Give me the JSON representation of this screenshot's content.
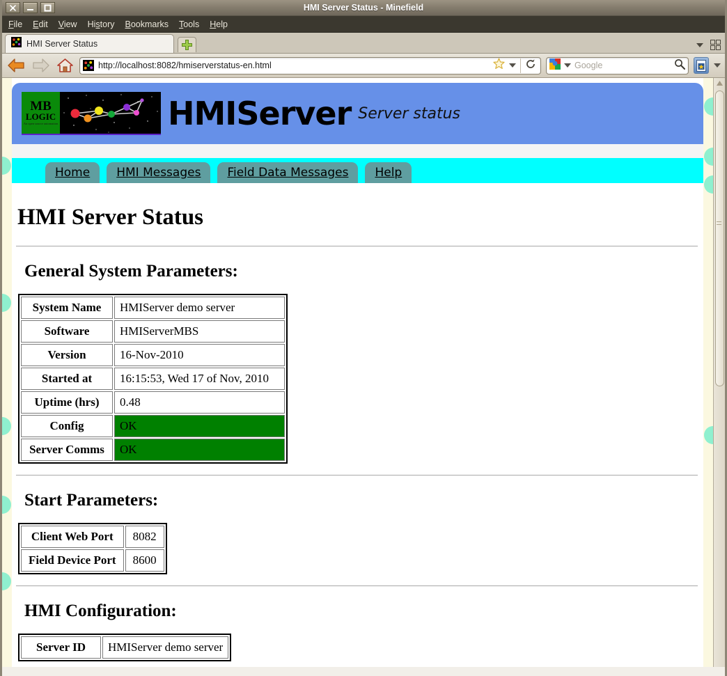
{
  "window": {
    "title": "HMI Server Status - Minefield",
    "buttons": [
      {
        "name": "close",
        "glyph": "✕"
      },
      {
        "name": "minimize",
        "glyph": "—"
      },
      {
        "name": "maximize",
        "glyph": "□"
      }
    ]
  },
  "menubar": {
    "items": [
      {
        "label": "File",
        "accel": "F"
      },
      {
        "label": "Edit",
        "accel": "E"
      },
      {
        "label": "View",
        "accel": "V"
      },
      {
        "label": "History",
        "accel": "s"
      },
      {
        "label": "Bookmarks",
        "accel": "B"
      },
      {
        "label": "Tools",
        "accel": "T"
      },
      {
        "label": "Help",
        "accel": "H"
      }
    ]
  },
  "tabbar": {
    "tab_title": "HMI Server Status",
    "new_tab_label": "+",
    "list_all_tabs_icon": "chevron-down-icon",
    "tab_groups_icon": "tab-groups-icon"
  },
  "toolbar": {
    "back_icon": "back-arrow-icon",
    "forward_icon": "forward-arrow-icon",
    "home_icon": "home-icon",
    "url": "http://localhost:8082/hmiserverstatus-en.html",
    "bookmark_star_icon": "star-icon",
    "reload_icon": "reload-icon",
    "search_engine": "Google",
    "search_placeholder": "Google",
    "search_icon": "magnifier-icon",
    "bookmarks_button_icon": "bookmarks-icon"
  },
  "page": {
    "logo": {
      "line1": "MB",
      "line2": "LOGIC",
      "line3": "An open source automation"
    },
    "app_title": "HMIServer",
    "subtitle": "Server status",
    "nav_tabs": [
      {
        "label": "Home"
      },
      {
        "label": "HMI Messages"
      },
      {
        "label": "Field Data Messages"
      },
      {
        "label": "Help"
      }
    ],
    "heading": "HMI Server Status",
    "sections": [
      {
        "id": "general",
        "heading": "General System Parameters:",
        "rows": [
          {
            "key": "System Name",
            "value": "HMIServer demo server",
            "status": false
          },
          {
            "key": "Software",
            "value": "HMIServerMBS",
            "status": false
          },
          {
            "key": "Version",
            "value": "16-Nov-2010",
            "status": false
          },
          {
            "key": "Started at",
            "value": "16:15:53, Wed 17 of Nov, 2010",
            "status": false
          },
          {
            "key": "Uptime (hrs)",
            "value": "0.48",
            "status": false
          },
          {
            "key": "Config",
            "value": "OK",
            "status": true
          },
          {
            "key": "Server Comms",
            "value": "OK",
            "status": true
          }
        ]
      },
      {
        "id": "start",
        "heading": "Start Parameters:",
        "rows": [
          {
            "key": "Client Web Port",
            "value": "8082",
            "status": false
          },
          {
            "key": "Field Device Port",
            "value": "8600",
            "status": false
          }
        ]
      },
      {
        "id": "hmiconfig",
        "heading": "HMI Configuration:",
        "rows": [
          {
            "key": "Server ID",
            "value": "HMIServer demo server",
            "status": false
          }
        ]
      }
    ],
    "colors": {
      "banner": "#6690e8",
      "navtab_bar": "#00ffff",
      "navtab": "#5f9ea0",
      "status_ok": "#008000",
      "margin": "#fbf8e0",
      "margin_blob": "#8ff0cf"
    }
  }
}
